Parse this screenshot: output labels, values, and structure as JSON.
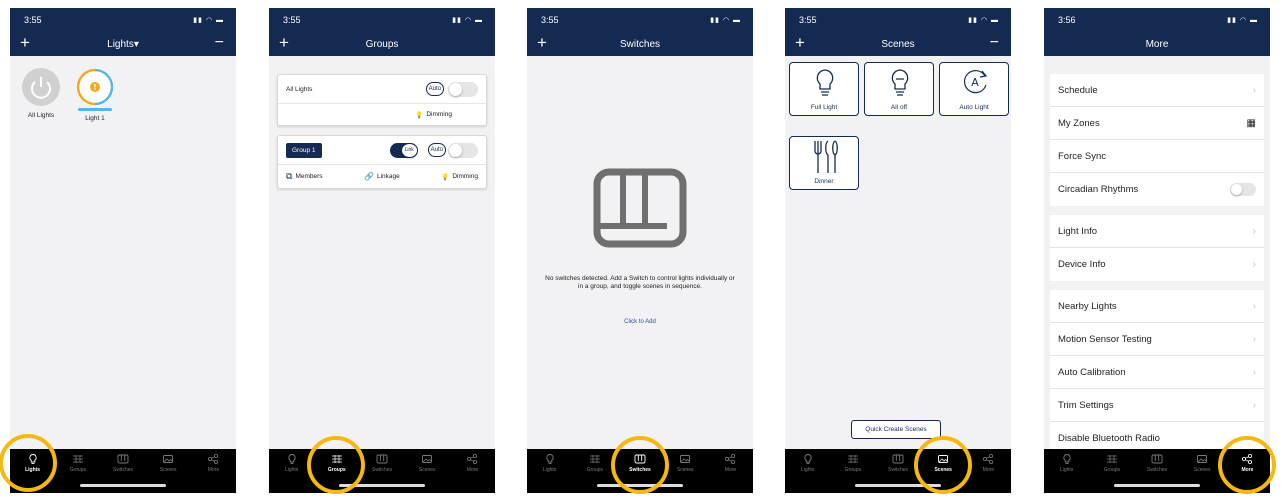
{
  "colors": {
    "navy": "#142a52",
    "highlight": "#f4b80f",
    "tabbar": "#000000"
  },
  "tabs": [
    {
      "label": "Lights",
      "icon": "bulb-icon"
    },
    {
      "label": "Groups",
      "icon": "grid-icon"
    },
    {
      "label": "Switches",
      "icon": "switch-icon"
    },
    {
      "label": "Scenes",
      "icon": "image-icon"
    },
    {
      "label": "More",
      "icon": "share-icon"
    }
  ],
  "screens": {
    "lights": {
      "time": "3:55",
      "title": "Lights▾",
      "tiles": [
        {
          "label": "All Lights"
        },
        {
          "label": "Light 1"
        }
      ]
    },
    "groups": {
      "time": "3:55",
      "title": "Groups",
      "all_lights": {
        "name": "All Lights",
        "auto": "Auto",
        "dimming": "Dimming"
      },
      "group1": {
        "name": "Group 1",
        "link": "Link",
        "auto": "Auto",
        "members": "Members",
        "linkage": "Linkage",
        "dimming": "Dimming"
      }
    },
    "switches": {
      "time": "3:55",
      "title": "Switches",
      "message": "No switches detected. Add a Switch to control lights individually or in a group, and toggle scenes in sequence.",
      "cta": "Click to Add"
    },
    "scenes": {
      "time": "3:55",
      "title": "Scenes",
      "items": [
        {
          "label": "Full Light"
        },
        {
          "label": "All off"
        },
        {
          "label": "Auto Light"
        },
        {
          "label": "Dinner"
        }
      ],
      "quick_create": "Quick Create Scenes"
    },
    "more": {
      "time": "3:56",
      "title": "More",
      "group1": [
        "Schedule",
        "My Zones",
        "Force Sync",
        "Circadian Rhythms"
      ],
      "group2": [
        "Light Info",
        "Device Info"
      ],
      "group3": [
        "Nearby Lights",
        "Motion Sensor Testing",
        "Auto Calibration",
        "Trim Settings",
        "Disable Bluetooth Radio"
      ]
    }
  }
}
